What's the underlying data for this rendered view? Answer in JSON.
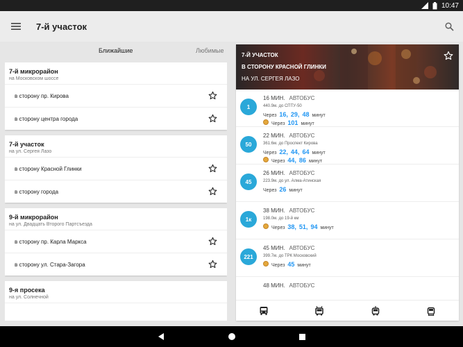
{
  "status_bar": {
    "time": "10:47"
  },
  "app_bar": {
    "title": "7-й участок"
  },
  "tabs": {
    "nearest": "Ближайшие",
    "favorites": "Любимые"
  },
  "stops": [
    {
      "name": "7-й микрорайон",
      "sub": "на Московском шоссе",
      "directions": [
        "в сторону пр. Кирова",
        "в сторону центра города"
      ]
    },
    {
      "name": "7-й участок",
      "sub": "на ул. Сергея Лазо",
      "directions": [
        "в сторону Красной Глинки",
        "в сторону города"
      ]
    },
    {
      "name": "9-й микрорайон",
      "sub": "на ул. Двадцать Второго Партсъезда",
      "directions": [
        "в сторону пр. Карла Маркса",
        "в сторону ул. Стара-Загора"
      ]
    },
    {
      "name": "9-я просека",
      "sub": "на ул. Солнечной",
      "directions": []
    }
  ],
  "detail": {
    "stop": "7-Й УЧАСТОК",
    "direction": "В СТОРОНУ КРАСНОЙ ГЛИНКИ",
    "street": "НА УЛ. СЕРГЕЯ ЛАЗО",
    "labels": {
      "through": "Через",
      "minutes": "минут"
    },
    "arrivals": [
      {
        "route": "1",
        "time": "16 МИН.",
        "type": "АВТОБУС",
        "distance": "440.9м. до СПТУ-50",
        "times": [
          "16,",
          "29,",
          "48"
        ],
        "coin_times": [
          "101"
        ]
      },
      {
        "route": "50",
        "time": "22 МИН.",
        "type": "АВТОБУС",
        "distance": "361.6м. до Проспект Кирова",
        "times": [
          "22,",
          "44,",
          "64"
        ],
        "coin_times": [
          "44,",
          "86"
        ]
      },
      {
        "route": "45",
        "time": "26 МИН.",
        "type": "АВТОБУС",
        "distance": "223.9м. до ул. Алма-Атинская",
        "times": [
          "26"
        ],
        "coin_times": []
      },
      {
        "route": "1к",
        "time": "38 МИН.",
        "type": "АВТОБУС",
        "distance": "198.0м. до 19-й км",
        "times": [],
        "coin_times": [
          "38,",
          "51,",
          "94"
        ]
      },
      {
        "route": "221",
        "time": "45 МИН.",
        "type": "АВТОБУС",
        "distance": "399.7м. до ТРК Московский",
        "times": [],
        "coin_times": [
          "45"
        ]
      },
      {
        "route": "",
        "time": "48 МИН.",
        "type": "АВТОБУС",
        "distance": "",
        "times": [],
        "coin_times": []
      }
    ]
  },
  "colors": {
    "accent": "#2196f3",
    "badge": "#2aa8d9",
    "coin": "#e4a83c"
  },
  "icons": {
    "menu": "menu-icon",
    "search": "search-icon",
    "star": "star-outline-icon",
    "bus": "bus-icon",
    "trolleybus": "trolleybus-icon",
    "tram": "tram-icon"
  }
}
